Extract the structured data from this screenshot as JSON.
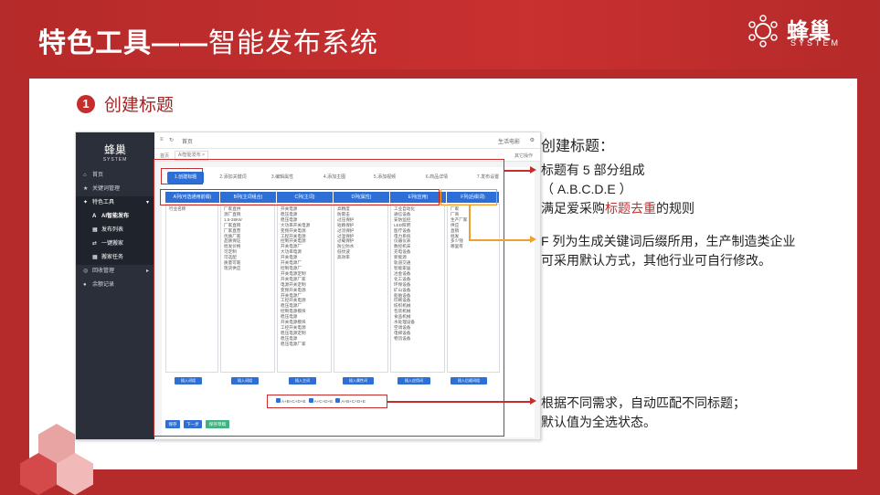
{
  "header": {
    "title_main": "特色工具——",
    "title_sub": "智能发布系统",
    "logo_text": "蜂巢",
    "logo_sub": "SYSTEM"
  },
  "step": {
    "number": "1",
    "title": "创建标题"
  },
  "app": {
    "logo_text": "蜂巢",
    "sidebar": [
      {
        "label": "首页",
        "icon": "home-icon"
      },
      {
        "label": "关键词管理",
        "icon": "star-icon"
      },
      {
        "label": "特色工具",
        "icon": "thumb-icon"
      },
      {
        "label": "AI智能发布",
        "icon": "ai-icon"
      },
      {
        "label": "发布列表",
        "icon": "grid-icon"
      },
      {
        "label": "一键搬家",
        "icon": "move-icon"
      },
      {
        "label": "搬家任务",
        "icon": "grid-icon"
      },
      {
        "label": "回收管理",
        "icon": "recycle-icon"
      },
      {
        "label": "余额记录",
        "icon": "user-icon"
      }
    ],
    "topbar": {
      "crumb": "首页",
      "user": "生活电影",
      "menu": "其它操作"
    },
    "tabs": {
      "home": "首页",
      "current": "AI智能发布 ×"
    },
    "steps": [
      "1.创建标题",
      "2.添加关键词",
      "3.编辑属性",
      "4.添加主图",
      "5.添加视频",
      "6.商品详情",
      "7.发布设置"
    ],
    "columns": [
      {
        "head": "A列(可选通用前缀)",
        "items": [
          "行业名称"
        ]
      },
      {
        "head": "B列(主词组合)",
        "items": [
          "厂家直供",
          "源厂直销",
          "1.5-38kW",
          "厂家直销",
          "厂家直营",
          "优质厂家",
          "品质保证",
          "批发价格",
          "可定制",
          "可选配",
          "质量可靠",
          "现货供应"
        ]
      },
      {
        "head": "C列(主词)",
        "items": [
          "开关电源",
          "稳压电源",
          "稳压电源",
          "大功率开关电源",
          "变频开关电源",
          "工程开关电源",
          "控制开关电源",
          "开关电源厂",
          "大功率电源",
          "开关电源",
          "开关电源厂",
          "控制电源厂",
          "开关电源定制",
          "开关电源厂家",
          "电源开关定制",
          "变频开关电源",
          "开关电源厂",
          "工控开关电源",
          "稳压电源厂",
          "控制电源模块",
          "稳压电源",
          "开关电源模块",
          "工控开关电源",
          "稳压电源定制",
          "稳压电源",
          "稳压电源厂家"
        ]
      },
      {
        "head": "D列(属性)",
        "items": [
          "高精度",
          "防雷击",
          "过压保护",
          "短路保护",
          "过流保护",
          "过温保护",
          "过载保护",
          "防尘防水",
          "低纹波",
          "高效率"
        ]
      },
      {
        "head": "E列(应用)",
        "items": [
          "工业自动化",
          "通信设备",
          "安防监控",
          "LED照明",
          "医疗设备",
          "电力系统",
          "仪器仪表",
          "数控机床",
          "充电设备",
          "新能源",
          "轨道交通",
          "智能家居",
          "冶金设备",
          "化工设备",
          "环保设备",
          "矿山设备",
          "船舶设备",
          "印刷设备",
          "纺织机械",
          "包装机械",
          "食品机械",
          "水处理设备",
          "空调设备",
          "电梯设备",
          "物流设备"
        ]
      },
      {
        "head": "F列(后缀词)",
        "items": [
          "厂家",
          "厂商",
          "生产厂家",
          "供应",
          "直销",
          "批发",
          "多少钱",
          "哪里有"
        ]
      }
    ],
    "buttons": [
      "插入词组",
      "插入词组",
      "插入主词",
      "插入属性词",
      "插入应用词",
      "插入后缀词组"
    ],
    "checks": [
      "A+B+C+D+E",
      "A+C+D+E",
      "A+B+C+D+E"
    ],
    "actions": {
      "prev": "保存",
      "next": "下一步",
      "save": "保存草稿"
    }
  },
  "notes": {
    "title": "创建标题：",
    "n1_l1": "标题有 5 部分组成",
    "n1_l2": "（ A.B.C.D.E ）",
    "n1_l3_a": "满足爱采购",
    "n1_l3_hl": "标题去重",
    "n1_l3_b": "的规则",
    "n2_l1": "F 列为生成关键词后缀所用，生产制造类企业",
    "n2_l2": "可采用默认方式，其他行业可自行修改。",
    "n3_l1": "根据不同需求，自动匹配不同标题；",
    "n3_l2": "默认值为全选状态。"
  },
  "colors": {
    "brand_red": "#b52a2a",
    "accent_blue": "#2d6fd6",
    "annotation_orange": "#f0a030"
  }
}
